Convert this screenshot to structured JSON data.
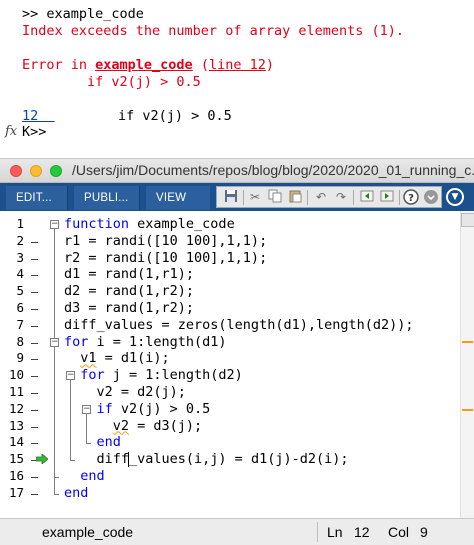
{
  "command_window": {
    "prompt_line": ">> example_code",
    "error_message": "Index exceeds the number of array elements (1).",
    "error_prefix": "Error in ",
    "error_function": "example_code",
    "error_line_ref": "line 12",
    "error_code": "if v2(j) > 0.5",
    "debug_line_number": "12",
    "debug_code": "if v2(j) > 0.5",
    "fx_symbol": "fx",
    "debug_prompt": "K>>"
  },
  "editor_window": {
    "title": "/Users/jim/Documents/repos/blog/blog/2020/2020_01_running_c...",
    "tabs": [
      "EDIT...",
      "PUBLI...",
      "VIEW"
    ],
    "toolbar_icons": [
      "save-icon",
      "cut-icon",
      "copy-icon",
      "paste-icon",
      "undo-icon",
      "redo-icon",
      "back-icon",
      "forward-icon",
      "help-icon",
      "dropdown-icon"
    ],
    "line_numbers": [
      "1",
      "2",
      "3",
      "4",
      "5",
      "6",
      "7",
      "8",
      "9",
      "10",
      "11",
      "12",
      "13",
      "14",
      "15",
      "16",
      "17"
    ],
    "code_lines": [
      {
        "kw": "function",
        "text": " example_code"
      },
      {
        "kw": "",
        "text": "r1 = randi([10 100],1,1);"
      },
      {
        "kw": "",
        "text": "r2 = randi([10 100],1,1);"
      },
      {
        "kw": "",
        "text": "d1 = rand(1,r1);"
      },
      {
        "kw": "",
        "text": "d2 = rand(1,r2);"
      },
      {
        "kw": "",
        "text": "d3 = rand(1,r2);"
      },
      {
        "kw": "",
        "text": "diff_values = zeros(length(d1),length(d2));"
      },
      {
        "kw": "for",
        "text": " i = 1:length(d1)"
      },
      {
        "kw": "",
        "squig": "v1",
        "text": " = d1(i);"
      },
      {
        "kw": "for",
        "text": " j = 1:length(d2)"
      },
      {
        "kw": "",
        "text": "v2 = d2(j);"
      },
      {
        "kw": "if",
        "text": " v2(j) > 0.5"
      },
      {
        "kw": "",
        "squig": "v2",
        "text": " = d3(j);"
      },
      {
        "kw": "end",
        "text": ""
      },
      {
        "kw": "",
        "text": "diff_values(i,j) = d1(j)-d2(i);"
      },
      {
        "kw": "end",
        "text": ""
      },
      {
        "kw": "end",
        "text": ""
      }
    ],
    "current_line": "12",
    "status": {
      "file": "example_code",
      "ln_label": "Ln",
      "ln_value": "12",
      "col_label": "Col",
      "col_value": "9"
    },
    "colors": {
      "keyword": "#0000ff",
      "error": "#e3001b",
      "link": "#0a3cc8",
      "toolstrip": "#1c4f8d",
      "warning": "#f39c12"
    }
  }
}
